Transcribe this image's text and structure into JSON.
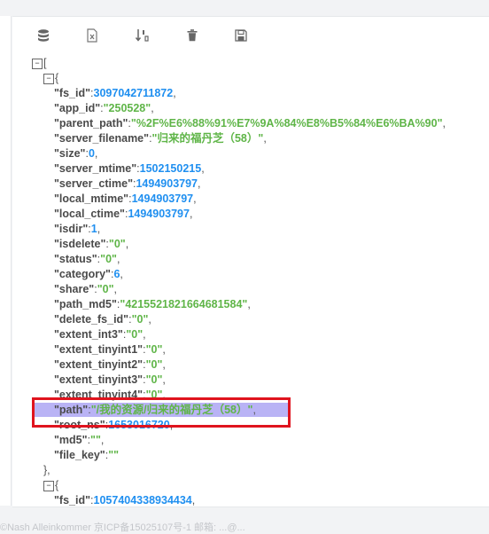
{
  "toolbar": {
    "icons": [
      "database-icon",
      "excel-file-icon",
      "sort-icon",
      "trash-icon",
      "save-icon"
    ]
  },
  "tree": {
    "root_open": "[",
    "obj_open": "{",
    "obj_close": "},",
    "item1": [
      {
        "key": "\"fs_id\"",
        "val": "3097042711872",
        "type": "num"
      },
      {
        "key": "\"app_id\"",
        "val": "\"250528\"",
        "type": "str"
      },
      {
        "key": "\"parent_path\"",
        "val": "\"%2F%E6%88%91%E7%9A%84%E8%B5%84%E6%BA%90\"",
        "type": "str"
      },
      {
        "key": "\"server_filename\"",
        "val": "\"归来的福丹芝（58）\"",
        "type": "str"
      },
      {
        "key": "\"size\"",
        "val": "0",
        "type": "num"
      },
      {
        "key": "\"server_mtime\"",
        "val": "1502150215",
        "type": "num"
      },
      {
        "key": "\"server_ctime\"",
        "val": "1494903797",
        "type": "num"
      },
      {
        "key": "\"local_mtime\"",
        "val": "1494903797",
        "type": "num"
      },
      {
        "key": "\"local_ctime\"",
        "val": "1494903797",
        "type": "num"
      },
      {
        "key": "\"isdir\"",
        "val": "1",
        "type": "num"
      },
      {
        "key": "\"isdelete\"",
        "val": "\"0\"",
        "type": "str"
      },
      {
        "key": "\"status\"",
        "val": "\"0\"",
        "type": "str"
      },
      {
        "key": "\"category\"",
        "val": "6",
        "type": "num"
      },
      {
        "key": "\"share\"",
        "val": "\"0\"",
        "type": "str"
      },
      {
        "key": "\"path_md5\"",
        "val": "\"4215521821664681584\"",
        "type": "str"
      },
      {
        "key": "\"delete_fs_id\"",
        "val": "\"0\"",
        "type": "str"
      },
      {
        "key": "\"extent_int3\"",
        "val": "\"0\"",
        "type": "str"
      },
      {
        "key": "\"extent_tinyint1\"",
        "val": "\"0\"",
        "type": "str"
      },
      {
        "key": "\"extent_tinyint2\"",
        "val": "\"0\"",
        "type": "str"
      },
      {
        "key": "\"extent_tinyint3\"",
        "val": "\"0\"",
        "type": "str"
      },
      {
        "key": "\"extent_tinyint4\"",
        "val": "\"0\"",
        "type": "str"
      },
      {
        "key": "\"path\"",
        "val": "\"/我的资源/归来的福丹芝（58）\"",
        "type": "str",
        "highlighted": true
      },
      {
        "key": "\"root_ns\"",
        "val": "1653016720",
        "type": "num"
      },
      {
        "key": "\"md5\"",
        "val": "\"\"",
        "type": "str"
      },
      {
        "key": "\"file_key\"",
        "val": "\"\"",
        "type": "str",
        "last": true
      }
    ],
    "item2_first": {
      "key": "\"fs_id\"",
      "val": "1057404338934434",
      "type": "num"
    }
  },
  "footer": {
    "text": "©Nash Alleinkommer 京ICP备15025107号-1 邮箱: ...@..."
  },
  "colors": {
    "key": "#4a4a4a",
    "number": "#1f8ff0",
    "string": "#5fb548",
    "highlight": "#b9b3f5",
    "callout": "#e0141e"
  }
}
